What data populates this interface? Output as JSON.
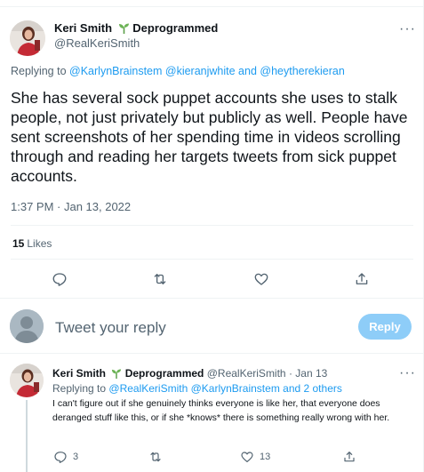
{
  "main_tweet": {
    "author_name": "Keri Smith",
    "author_badge": "Deprogrammed",
    "author_handle": "@RealKeriSmith",
    "replying_prefix": "Replying to",
    "replying_to": "@KarlynBrainstem @kieranjwhite and @heytherekieran",
    "text": "She has several sock puppet accounts she uses to stalk people, not just privately but publicly as well. People have sent screenshots of her spending time in videos scrolling through and reading her targets tweets from sick puppet accounts.",
    "timestamp": "1:37 PM · Jan 13, 2022",
    "likes_count": "15",
    "likes_label": "Likes"
  },
  "reply_box": {
    "placeholder": "Tweet your reply",
    "button_label": "Reply"
  },
  "reply_tweet": {
    "author_name": "Keri Smith",
    "author_badge": "Deprogrammed",
    "author_handle": "@RealKeriSmith · Jan 13",
    "replying_prefix": "Replying to",
    "replying_to": "@RealKeriSmith @KarlynBrainstem and 2 others",
    "text": "I can't figure out if she genuinely thinks everyone is like her, that everyone does deranged stuff like this, or if she *knows* there is something really wrong with her.",
    "reply_count": "3",
    "like_count": "13"
  },
  "icons": {
    "more": "more-icon",
    "reply": "reply-icon",
    "retweet": "retweet-icon",
    "like": "like-icon",
    "share": "share-icon",
    "seedling": "seedling-icon"
  },
  "colors": {
    "link": "#1d9bf0",
    "muted": "#536471",
    "reply_button": "#8ecdf8",
    "seedling": "#5ca04a"
  }
}
